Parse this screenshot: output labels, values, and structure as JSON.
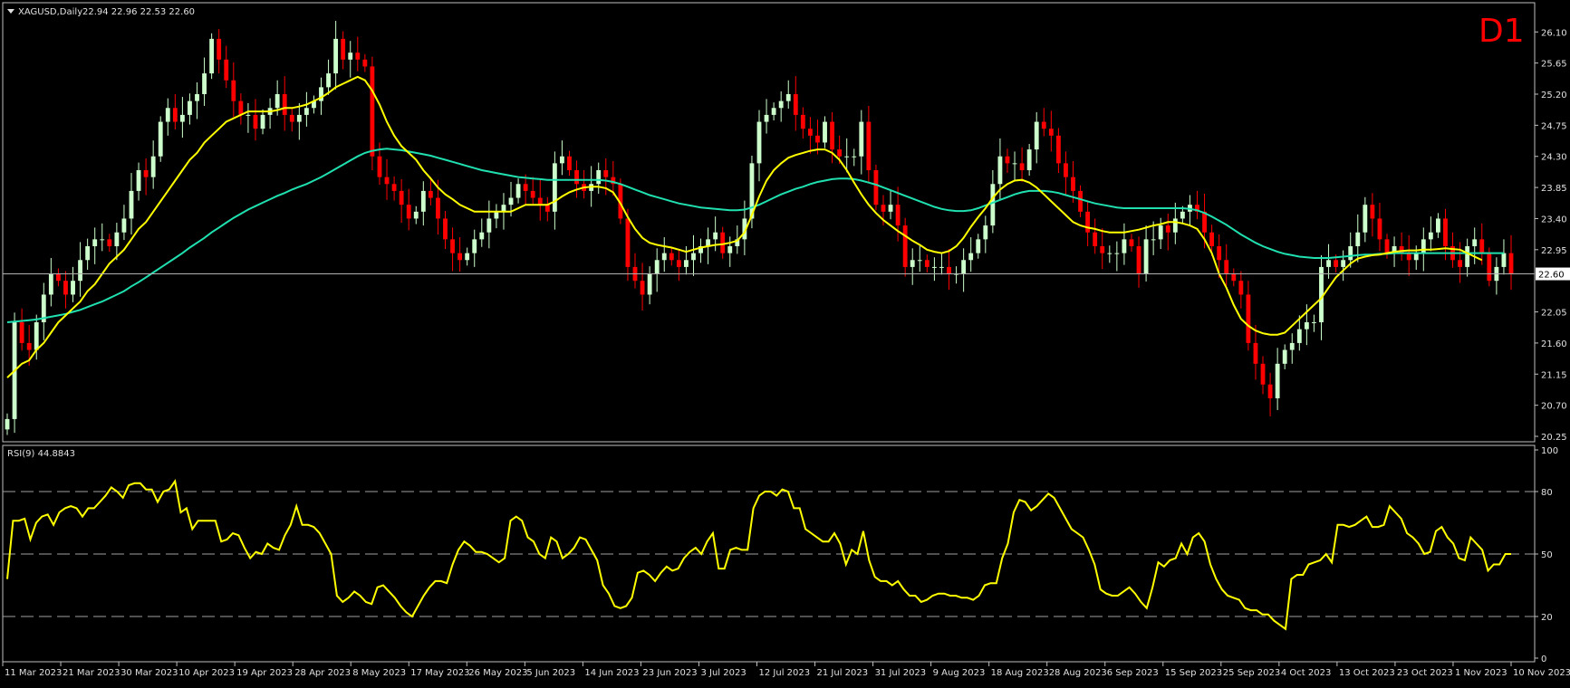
{
  "header": {
    "symbol": "XAGUSD,Daily",
    "ohlc": "22.94 22.96 22.53 22.60",
    "timeframe_badge": "D1"
  },
  "rsi_panel": {
    "label": "RSI(9) 44.8843"
  },
  "colors": {
    "background": "#000000",
    "frame": "#c0c0c0",
    "bull_candle": "#ccffcc",
    "bear_candle": "#ff0000",
    "fast_ma": "#ffff00",
    "slow_ma": "#20e0b0",
    "rsi_line": "#ffff00",
    "badge": "#ff0000",
    "text": "#e0e0e0",
    "level_line": "#a0a0a0"
  },
  "icons": {
    "symbol_dropdown": "triangle-down-icon"
  },
  "chart_data": [
    {
      "type": "candlestick",
      "panel": "price",
      "ylim": [
        20.25,
        26.3
      ],
      "y_ticks": [
        "26.10",
        "25.65",
        "25.20",
        "24.75",
        "24.30",
        "23.85",
        "23.40",
        "22.95",
        "22.60",
        "22.05",
        "21.60",
        "21.15",
        "20.70",
        "20.25"
      ],
      "current_price": 22.6,
      "current_price_label": "22.60",
      "x_labels": [
        "11 Mar 2023",
        "21 Mar 2023",
        "30 Mar 2023",
        "10 Apr 2023",
        "19 Apr 2023",
        "28 Apr 2023",
        "8 May 2023",
        "17 May 2023",
        "26 May 2023",
        "5 Jun 2023",
        "14 Jun 2023",
        "23 Jun 2023",
        "3 Jul 2023",
        "12 Jul 2023",
        "21 Jul 2023",
        "31 Jul 2023",
        "9 Aug 2023",
        "18 Aug 2023",
        "28 Aug 2023",
        "6 Sep 2023",
        "15 Sep 2023",
        "25 Sep 2023",
        "4 Oct 2023",
        "13 Oct 2023",
        "23 Oct 2023",
        "1 Nov 2023",
        "10 Nov 2023"
      ],
      "closes": [
        20.5,
        21.9,
        21.6,
        21.5,
        21.9,
        22.3,
        22.6,
        22.5,
        22.3,
        22.5,
        22.8,
        23.0,
        23.1,
        23.1,
        23.0,
        23.2,
        23.4,
        23.8,
        24.1,
        24.0,
        24.3,
        24.8,
        25.0,
        24.8,
        24.9,
        25.1,
        25.2,
        25.5,
        26.0,
        25.7,
        25.4,
        25.1,
        24.9,
        24.9,
        24.7,
        24.9,
        25.0,
        25.2,
        24.9,
        24.8,
        24.9,
        25.0,
        25.1,
        25.3,
        25.5,
        26.0,
        25.7,
        25.8,
        25.7,
        25.6,
        24.3,
        24.0,
        23.9,
        23.8,
        23.6,
        23.4,
        23.5,
        23.8,
        23.7,
        23.4,
        23.1,
        22.9,
        22.8,
        22.9,
        23.1,
        23.2,
        23.4,
        23.5,
        23.6,
        23.7,
        23.9,
        23.8,
        23.7,
        23.6,
        23.5,
        24.2,
        24.3,
        24.1,
        23.9,
        23.8,
        23.9,
        24.1,
        24.0,
        23.9,
        23.4,
        22.7,
        22.5,
        22.3,
        22.6,
        22.8,
        22.9,
        22.8,
        22.7,
        22.8,
        22.9,
        23.0,
        23.1,
        23.2,
        22.9,
        23.0,
        23.1,
        23.4,
        24.2,
        24.8,
        24.9,
        25.0,
        25.1,
        25.2,
        24.9,
        24.7,
        24.6,
        24.5,
        24.8,
        24.4,
        24.3,
        24.3,
        24.3,
        24.8,
        24.1,
        23.6,
        23.5,
        23.6,
        23.3,
        22.7,
        22.8,
        22.8,
        22.7,
        22.7,
        22.7,
        22.6,
        22.6,
        22.8,
        22.9,
        23.1,
        23.3,
        23.9,
        24.3,
        24.2,
        24.2,
        24.1,
        24.4,
        24.8,
        24.7,
        24.6,
        24.2,
        24.0,
        23.8,
        23.5,
        23.2,
        23.0,
        22.9,
        22.9,
        22.9,
        23.1,
        23.0,
        22.6,
        23.1,
        23.1,
        23.3,
        23.2,
        23.4,
        23.5,
        23.6,
        23.5,
        23.2,
        23.0,
        22.8,
        22.6,
        22.5,
        22.3,
        21.6,
        21.3,
        21.0,
        20.8,
        21.3,
        21.5,
        21.6,
        21.8,
        21.9,
        21.9,
        22.7,
        22.8,
        22.7,
        22.8,
        23.0,
        23.2,
        23.6,
        23.4,
        23.1,
        22.9,
        23.0,
        22.9,
        22.8,
        22.9,
        23.1,
        23.2,
        23.4,
        23.0,
        22.8,
        22.7,
        23.0,
        23.1,
        22.9,
        22.5,
        22.7,
        22.9,
        22.6
      ],
      "series": [
        {
          "name": "",
          "role": "fast_ma",
          "values": [
            21.1,
            21.2,
            21.3,
            21.35,
            21.5,
            21.6,
            21.75,
            21.9,
            22.0,
            22.1,
            22.2,
            22.35,
            22.45,
            22.6,
            22.75,
            22.85,
            22.95,
            23.1,
            23.25,
            23.35,
            23.5,
            23.65,
            23.8,
            23.95,
            24.1,
            24.25,
            24.35,
            24.5,
            24.6,
            24.7,
            24.8,
            24.85,
            24.9,
            24.95,
            24.95,
            24.95,
            24.95,
            24.97,
            25.0,
            25.0,
            25.02,
            25.05,
            25.1,
            25.15,
            25.22,
            25.3,
            25.35,
            25.4,
            25.45,
            25.4,
            25.25,
            25.05,
            24.8,
            24.6,
            24.45,
            24.35,
            24.25,
            24.1,
            23.98,
            23.85,
            23.75,
            23.68,
            23.6,
            23.55,
            23.5,
            23.5,
            23.5,
            23.5,
            23.5,
            23.5,
            23.55,
            23.6,
            23.6,
            23.6,
            23.6,
            23.65,
            23.72,
            23.78,
            23.82,
            23.85,
            23.86,
            23.86,
            23.84,
            23.78,
            23.62,
            23.42,
            23.25,
            23.12,
            23.05,
            23.02,
            23.0,
            22.98,
            22.95,
            22.92,
            22.95,
            22.98,
            23.0,
            23.02,
            23.03,
            23.05,
            23.08,
            23.2,
            23.45,
            23.72,
            23.95,
            24.1,
            24.2,
            24.28,
            24.32,
            24.35,
            24.38,
            24.4,
            24.4,
            24.35,
            24.25,
            24.1,
            23.92,
            23.75,
            23.6,
            23.48,
            23.38,
            23.3,
            23.22,
            23.15,
            23.08,
            23.02,
            22.95,
            22.92,
            22.9,
            22.93,
            23.0,
            23.12,
            23.28,
            23.42,
            23.55,
            23.7,
            23.82,
            23.9,
            23.95,
            23.96,
            23.92,
            23.85,
            23.75,
            23.65,
            23.55,
            23.45,
            23.35,
            23.3,
            23.27,
            23.25,
            23.22,
            23.2,
            23.2,
            23.2,
            23.22,
            23.24,
            23.27,
            23.3,
            23.32,
            23.35,
            23.35,
            23.33,
            23.3,
            23.25,
            23.1,
            22.9,
            22.6,
            22.4,
            22.15,
            21.95,
            21.85,
            21.78,
            21.74,
            21.72,
            21.72,
            21.75,
            21.85,
            21.95,
            22.05,
            22.15,
            22.25,
            22.4,
            22.55,
            22.65,
            22.75,
            22.82,
            22.85,
            22.87,
            22.88,
            22.9,
            22.92,
            22.93,
            22.94,
            22.94,
            22.95,
            22.95,
            22.96,
            22.97,
            22.96,
            22.95,
            22.9,
            22.85,
            22.8
          ]
        },
        {
          "name": "",
          "role": "slow_ma",
          "values": [
            21.9,
            21.91,
            21.92,
            21.93,
            21.94,
            21.96,
            21.98,
            22.0,
            22.02,
            22.05,
            22.08,
            22.12,
            22.16,
            22.2,
            22.25,
            22.3,
            22.35,
            22.42,
            22.48,
            22.55,
            22.62,
            22.69,
            22.76,
            22.83,
            22.9,
            22.98,
            23.05,
            23.12,
            23.2,
            23.27,
            23.34,
            23.41,
            23.47,
            23.53,
            23.58,
            23.63,
            23.68,
            23.73,
            23.77,
            23.82,
            23.86,
            23.9,
            23.95,
            24.0,
            24.06,
            24.12,
            24.18,
            24.24,
            24.3,
            24.35,
            24.38,
            24.4,
            24.41,
            24.4,
            24.39,
            24.37,
            24.35,
            24.33,
            24.31,
            24.28,
            24.25,
            24.22,
            24.19,
            24.16,
            24.13,
            24.1,
            24.08,
            24.06,
            24.04,
            24.02,
            24.0,
            23.99,
            23.98,
            23.97,
            23.96,
            23.96,
            23.96,
            23.96,
            23.96,
            23.96,
            23.96,
            23.96,
            23.95,
            23.93,
            23.9,
            23.86,
            23.82,
            23.78,
            23.74,
            23.71,
            23.68,
            23.65,
            23.62,
            23.6,
            23.58,
            23.56,
            23.55,
            23.54,
            23.53,
            23.52,
            23.52,
            23.53,
            23.56,
            23.6,
            23.65,
            23.7,
            23.75,
            23.79,
            23.83,
            23.86,
            23.9,
            23.93,
            23.95,
            23.97,
            23.98,
            23.98,
            23.97,
            23.95,
            23.92,
            23.89,
            23.85,
            23.81,
            23.77,
            23.73,
            23.69,
            23.65,
            23.61,
            23.57,
            23.54,
            23.52,
            23.51,
            23.51,
            23.52,
            23.55,
            23.59,
            23.63,
            23.67,
            23.71,
            23.75,
            23.78,
            23.8,
            23.8,
            23.8,
            23.79,
            23.77,
            23.74,
            23.71,
            23.68,
            23.65,
            23.62,
            23.6,
            23.58,
            23.56,
            23.55,
            23.55,
            23.55,
            23.55,
            23.55,
            23.55,
            23.55,
            23.55,
            23.55,
            23.54,
            23.52,
            23.48,
            23.43,
            23.37,
            23.31,
            23.24,
            23.17,
            23.11,
            23.05,
            23.0,
            22.96,
            22.92,
            22.89,
            22.87,
            22.85,
            22.84,
            22.83,
            22.83,
            22.83,
            22.84,
            22.85,
            22.86,
            22.87,
            22.88,
            22.88,
            22.89,
            22.89,
            22.9,
            22.9,
            22.9,
            22.9,
            22.9,
            22.9,
            22.9,
            22.9,
            22.9,
            22.9,
            22.9,
            22.9,
            22.9,
            22.9,
            22.9,
            22.9
          ]
        }
      ]
    },
    {
      "type": "line",
      "panel": "rsi",
      "ylim": [
        0,
        100
      ],
      "y_ticks": [
        "100",
        "80",
        "50",
        "20",
        "0"
      ],
      "levels": [
        80,
        50,
        20
      ],
      "series": [
        {
          "name": "",
          "values": [
            38,
            66,
            66,
            67,
            57,
            65,
            68,
            69,
            64,
            70,
            72,
            73,
            72,
            68,
            72,
            72,
            75,
            78,
            82,
            80,
            77,
            83,
            84,
            84,
            81,
            81,
            75,
            80,
            81,
            85,
            70,
            72,
            62,
            66,
            66,
            66,
            66,
            56,
            57,
            60,
            59,
            53,
            48,
            51,
            50,
            55,
            53,
            52,
            59,
            64,
            73,
            64,
            64,
            63,
            60,
            55,
            50,
            30,
            27,
            29,
            32,
            30,
            27,
            26,
            34,
            35,
            32,
            29,
            25,
            22,
            20,
            25,
            30,
            34,
            37,
            37,
            36,
            45,
            52,
            56,
            54,
            51,
            51,
            50,
            48,
            46,
            48,
            66,
            68,
            66,
            58,
            56,
            50,
            48,
            58,
            56,
            48,
            50,
            53,
            58,
            57,
            52,
            47,
            35,
            31,
            25,
            24,
            25,
            29,
            41,
            42,
            40,
            37,
            41,
            44,
            42,
            43,
            48,
            51,
            53,
            50,
            56,
            60,
            43,
            43,
            52,
            53,
            52,
            52,
            72,
            78,
            80,
            80,
            78,
            81,
            80,
            72,
            72,
            62,
            60,
            58,
            56,
            56,
            60,
            55,
            45,
            52,
            50,
            61,
            47,
            39,
            37,
            37,
            35,
            37,
            33,
            30,
            30,
            27,
            28,
            30,
            31,
            31,
            30,
            30,
            29,
            29,
            28,
            30,
            35,
            36,
            36,
            48,
            55,
            70,
            76,
            75,
            71,
            73,
            76,
            79,
            77,
            72,
            67,
            62,
            60,
            58,
            52,
            45,
            33,
            31,
            30,
            30,
            32,
            34,
            31,
            27,
            24,
            34,
            46,
            44,
            47,
            48,
            55,
            50,
            58,
            60,
            56,
            45,
            38,
            33,
            30,
            29,
            28,
            24,
            23,
            23,
            21,
            21,
            18,
            16,
            14,
            38,
            40,
            40,
            45,
            46,
            47,
            50,
            46,
            64,
            64,
            63,
            64,
            66,
            68,
            63,
            63,
            64,
            73,
            70,
            67,
            60,
            58,
            55,
            50,
            51,
            61,
            63,
            58,
            55,
            48,
            47,
            58,
            55,
            52,
            42,
            45,
            45,
            50,
            50
          ]
        }
      ]
    }
  ]
}
